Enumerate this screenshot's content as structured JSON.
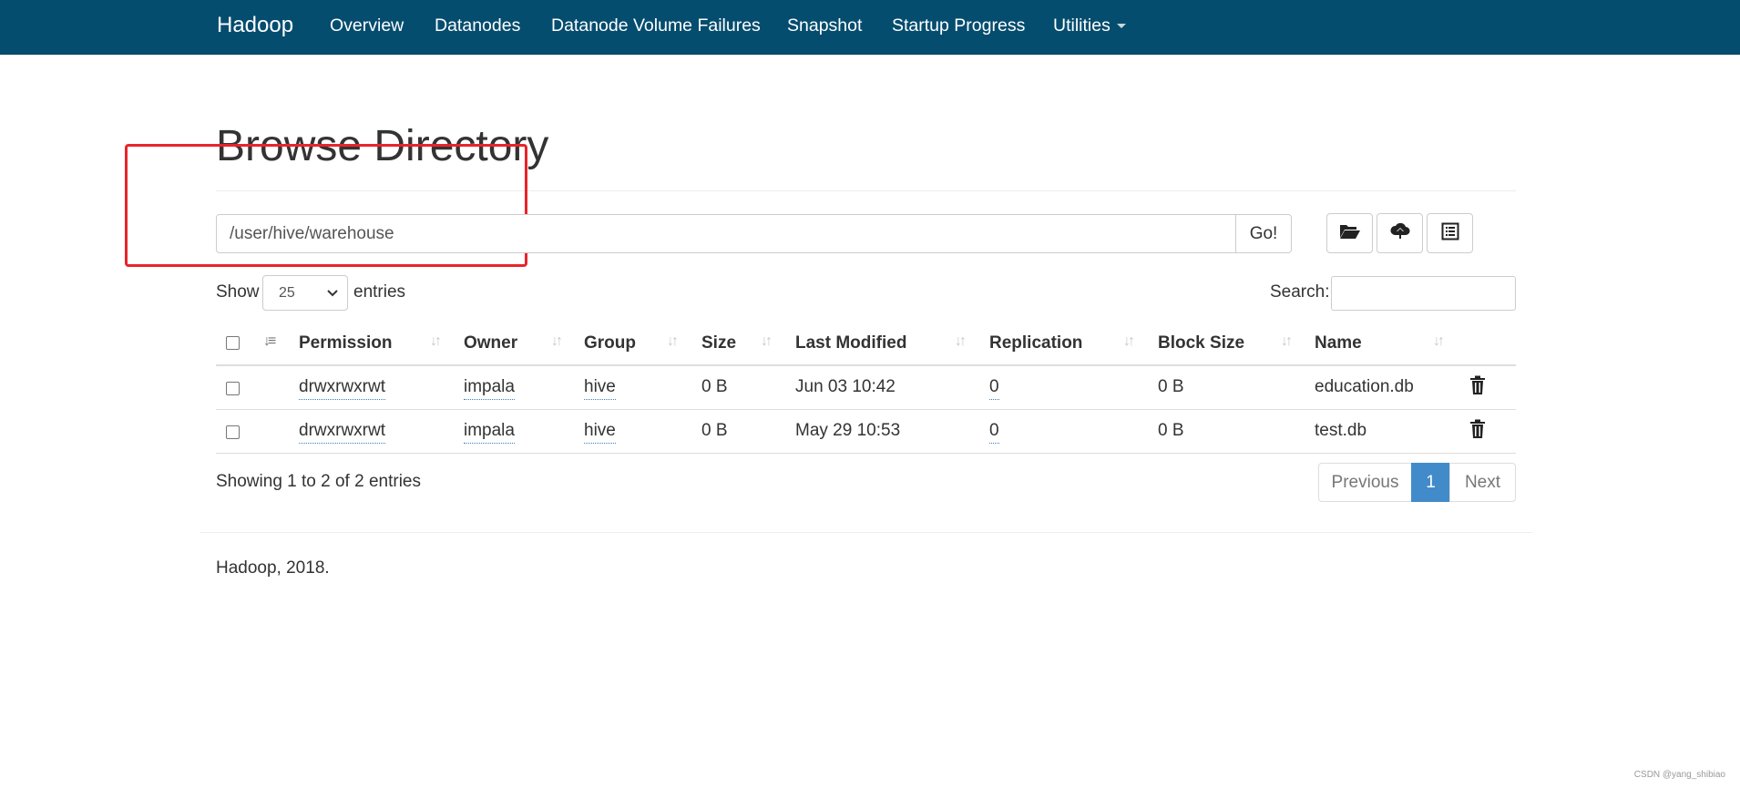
{
  "navbar": {
    "brand": "Hadoop",
    "links": [
      "Overview",
      "Datanodes",
      "Datanode Volume Failures",
      "Snapshot",
      "Startup Progress",
      "Utilities"
    ]
  },
  "page": {
    "title": "Browse Directory"
  },
  "path_bar": {
    "value": "/user/hive/warehouse",
    "go_label": "Go!",
    "tool_icons": [
      "folder-open-icon",
      "cloud-upload-icon",
      "list-alt-icon"
    ]
  },
  "length_control": {
    "show_label": "Show",
    "selected": "25",
    "entries_label": "entries"
  },
  "search": {
    "label": "Search:",
    "value": ""
  },
  "table": {
    "headers": [
      "Permission",
      "Owner",
      "Group",
      "Size",
      "Last Modified",
      "Replication",
      "Block Size",
      "Name"
    ],
    "rows": [
      {
        "permission": "drwxrwxrwt",
        "owner": "impala",
        "group": "hive",
        "size": "0 B",
        "last_modified": "Jun 03 10:42",
        "replication": "0",
        "block_size": "0 B",
        "name": "education.db"
      },
      {
        "permission": "drwxrwxrwt",
        "owner": "impala",
        "group": "hive",
        "size": "0 B",
        "last_modified": "May 29 10:53",
        "replication": "0",
        "block_size": "0 B",
        "name": "test.db"
      }
    ]
  },
  "pagination": {
    "info": "Showing 1 to 2 of 2 entries",
    "previous": "Previous",
    "current": "1",
    "next": "Next"
  },
  "footer": {
    "text": "Hadoop, 2018."
  },
  "watermark": "CSDN @yang_shibiao",
  "colors": {
    "navbar": "#054d6f",
    "link": "#337ab7",
    "annotation": "#e8242a",
    "active_page": "#428bca"
  }
}
